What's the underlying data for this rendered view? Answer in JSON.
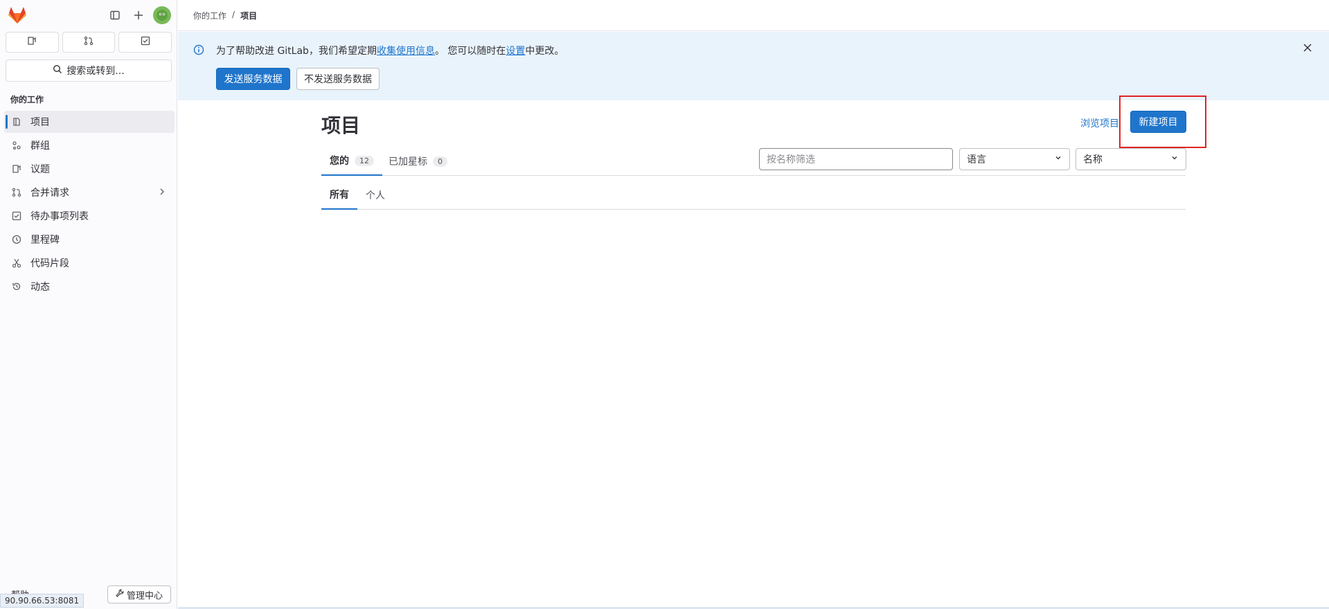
{
  "sidebar": {
    "section_title": "你的工作",
    "search_label": "搜索或转到...",
    "items": [
      {
        "label": "项目",
        "icon": "project-icon",
        "active": true
      },
      {
        "label": "群组",
        "icon": "group-icon"
      },
      {
        "label": "议题",
        "icon": "issues-icon"
      },
      {
        "label": "合并请求",
        "icon": "merge-request-icon",
        "chevron": true
      },
      {
        "label": "待办事项列表",
        "icon": "todo-icon"
      },
      {
        "label": "里程碑",
        "icon": "milestone-icon"
      },
      {
        "label": "代码片段",
        "icon": "snippet-icon"
      },
      {
        "label": "动态",
        "icon": "activity-icon"
      }
    ],
    "help_label": "帮助",
    "admin_label": "管理中心",
    "url_tooltip": "90.90.66.53:8081"
  },
  "breadcrumb": {
    "parent": "你的工作",
    "separator": "/",
    "current": "项目"
  },
  "banner": {
    "text_prefix": "为了帮助改进 GitLab，我们希望定期",
    "link1": "收集使用信息",
    "text_middle": "。 您可以随时在",
    "link2": "设置",
    "text_suffix": "中更改。",
    "send_label": "发送服务数据",
    "nosend_label": "不发送服务数据"
  },
  "main": {
    "title": "项目",
    "browse_label": "浏览项目",
    "new_project_label": "新建项目",
    "tabs": [
      {
        "label": "您的",
        "count": "12",
        "active": true
      },
      {
        "label": "已加星标",
        "count": "0"
      }
    ],
    "filter_placeholder": "按名称筛选",
    "language_select": "语言",
    "sort_select": "名称",
    "subtabs": [
      {
        "label": "所有",
        "active": true
      },
      {
        "label": "个人"
      }
    ]
  },
  "colors": {
    "accent": "#1f75cb",
    "highlight": "#e02424",
    "banner_bg": "#e9f3fc"
  }
}
